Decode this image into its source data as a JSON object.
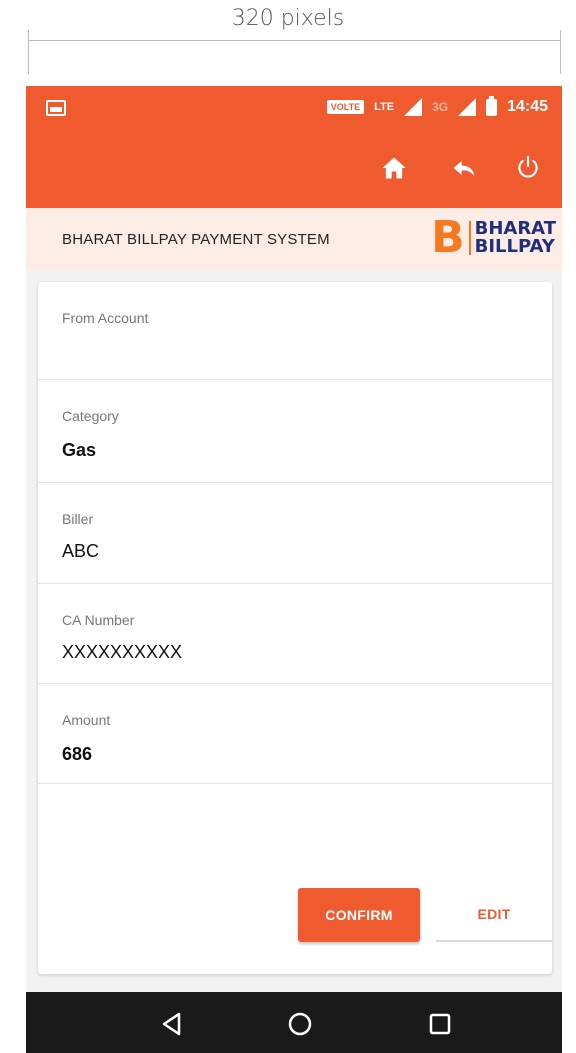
{
  "annotation": {
    "dimension_label": "320 pixels"
  },
  "status_bar": {
    "volte": "VOLTE",
    "lte": "LTE",
    "network_3g": "3G",
    "time": "14:45"
  },
  "app_bar": {
    "icons": [
      "home-icon",
      "back-icon",
      "power-icon"
    ]
  },
  "brand": {
    "title": "BHARAT BILLPAY PAYMENT SYSTEM",
    "logo_line1": "BHARAT",
    "logo_line2": "BILLPAY",
    "logo_letter": "B"
  },
  "form": {
    "from_account": {
      "label": "From Account",
      "value": ""
    },
    "category": {
      "label": "Category",
      "value": "Gas"
    },
    "biller": {
      "label": "Biller",
      "value": "ABC"
    },
    "ca_number": {
      "label": "CA Number",
      "value": "XXXXXXXXXX"
    },
    "amount": {
      "label": "Amount",
      "value": "686"
    }
  },
  "actions": {
    "confirm_label": "CONFIRM",
    "edit_label": "EDIT"
  },
  "colors": {
    "primary": "#f05a2f",
    "brand_bar_bg": "#fdece6",
    "logo_orange": "#f47a20",
    "logo_navy": "#1f2f7a"
  }
}
